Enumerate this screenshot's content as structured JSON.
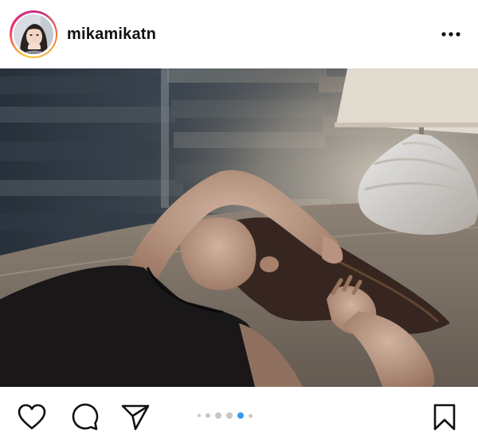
{
  "post": {
    "username": "mikamikatn",
    "carousel": {
      "total": 6,
      "active_index": 4
    }
  },
  "colors": {
    "active_dot": "#3797f0",
    "inactive_dot": "#c7c7c7",
    "icon": "#111111"
  },
  "icons": {
    "more": "more-horizontal-icon",
    "like": "heart-icon",
    "comment": "speech-bubble-icon",
    "share": "paper-plane-icon",
    "save": "bookmark-icon"
  }
}
